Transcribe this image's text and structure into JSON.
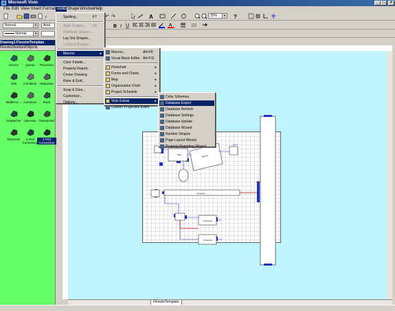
{
  "app": {
    "title": "Microsoft Visio"
  },
  "menubar": [
    "File",
    "Edit",
    "View",
    "Insert",
    "Format",
    "Tools",
    "Shape",
    "Window",
    "Help"
  ],
  "toolbar": {
    "style_value": "Normal",
    "font_value": "Arial",
    "line_style_value": "Normal",
    "zoom_value": "25%"
  },
  "stencil": {
    "window_title": "Drawing1:FlexsimTemplate",
    "name": "FlexsimStandardObjects",
    "masters": [
      {
        "label": "Source",
        "icon": "source-icon"
      },
      {
        "label": "Queue",
        "icon": "queue-icon"
      },
      {
        "label": "Processor",
        "icon": "processor-icon"
      },
      {
        "label": "Sink",
        "icon": "sink-icon"
      },
      {
        "label": "Combiner",
        "icon": "combiner-icon"
      },
      {
        "label": "Separator",
        "icon": "separator-icon"
      },
      {
        "label": "MultiProc...",
        "icon": "multiprocessor-icon"
      },
      {
        "label": "Conveyor",
        "icon": "conveyor-icon"
      },
      {
        "label": "Rack",
        "icon": "rack-icon"
      },
      {
        "label": "Dispatcher",
        "icon": "dispatcher-icon"
      },
      {
        "label": "Operator",
        "icon": "operator-icon"
      },
      {
        "label": "Transporter",
        "icon": "transporter-icon"
      },
      {
        "label": "Reservoir",
        "icon": "reservoir-icon"
      },
      {
        "label": "S Port Connection",
        "icon": "s-port-connection-icon"
      },
      {
        "label": "A Port Connection",
        "icon": "a-port-connection-icon"
      }
    ]
  },
  "tools_menu": [
    {
      "label": "Spelling...",
      "shortcut": "F7",
      "enabled": true
    },
    {
      "label": "Align Shapes...",
      "shortcut": "F8",
      "enabled": false
    },
    {
      "label": "Distribute Shapes...",
      "shortcut": "",
      "enabled": false
    },
    {
      "label": "Lay Out Shapes...",
      "shortcut": "",
      "enabled": true
    },
    {
      "label": "Connect Shapes",
      "shortcut": "",
      "enabled": false
    },
    {
      "label": "Macros",
      "shortcut": "",
      "enabled": true,
      "submenu": true,
      "highlighted": true
    },
    {
      "label": "Color Palette...",
      "shortcut": "",
      "enabled": true
    },
    {
      "label": "Property Report...",
      "shortcut": "",
      "enabled": true
    },
    {
      "label": "Center Drawing",
      "shortcut": "",
      "enabled": true
    },
    {
      "label": "Ruler & Grid...",
      "shortcut": "",
      "enabled": true
    },
    {
      "label": "Snap & Glue...",
      "shortcut": "",
      "enabled": true
    },
    {
      "label": "Customize...",
      "shortcut": "",
      "enabled": true
    },
    {
      "label": "Options...",
      "shortcut": "",
      "enabled": true
    }
  ],
  "macros_menu": [
    {
      "label": "Macros...",
      "shortcut": "Alt+F8"
    },
    {
      "label": "Visual Basic Editor",
      "shortcut": "Alt+F11"
    },
    {
      "label": "Flowchart",
      "submenu": true
    },
    {
      "label": "Forms and Charts",
      "submenu": true
    },
    {
      "label": "Map",
      "submenu": true
    },
    {
      "label": "Organization Chart",
      "submenu": true
    },
    {
      "label": "Project Schedule",
      "submenu": true
    },
    {
      "label": "Visio Extras",
      "submenu": true,
      "highlighted": true
    },
    {
      "label": "Custom Properties Editor"
    }
  ],
  "extras_menu": [
    {
      "label": "Color Schemes"
    },
    {
      "label": "Database Export",
      "highlighted": true
    },
    {
      "label": "Database Refresh"
    },
    {
      "label": "Database Settings"
    },
    {
      "label": "Database Update"
    },
    {
      "label": "Database Wizard"
    },
    {
      "label": "Number Shapes"
    },
    {
      "label": "Page Layout Wizard"
    },
    {
      "label": "Property Reporting Wizard"
    }
  ],
  "diagram": {
    "labels": {
      "sink": "Sink",
      "queue": "Queue",
      "conveyor": "Conveyor",
      "processor1": "Processor",
      "processor2": "Processor"
    }
  },
  "page_tab": "FlexsimTemplate",
  "colors": {
    "canvas": "#bff5ff",
    "stencil": "#66ff66",
    "highlight": "#0a246a",
    "connector": "#cc0000"
  }
}
